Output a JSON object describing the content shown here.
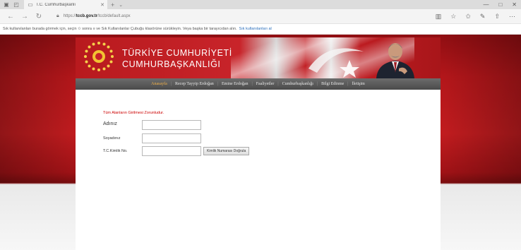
{
  "browser": {
    "tab_title": "T.C. Cumhurbaşkanlı",
    "address": {
      "prefix": "https://",
      "domain": "tccb.gov.tr",
      "path": "/tccb/default.aspx"
    },
    "favorites_bar": {
      "text": "Sık kullanılanları burada görmek için, seçin ✩ sonra ≡ ve Sık Kullanılanlar Çubuğu klasörüne sürükleyin. Veya başka bir tarayıcıdan alın.",
      "link": "Sık kullanılanları al"
    }
  },
  "header": {
    "line1": "TÜRKİYE CUMHURİYETİ",
    "line2": "CUMHURBAŞKANLIĞI"
  },
  "menu": {
    "items": [
      "Anasayfa",
      "Recep Tayyip Erdoğan",
      "Emine Erdoğan",
      "Faaliyetler",
      "Cumhurbaşkanlığı",
      "Bilgi Edinme",
      "İletişim"
    ]
  },
  "form": {
    "required_note": "Tüm Alanların Girilmesi Zorunludur.",
    "name_label": "Adınız",
    "surname_label": "Soyadınız",
    "tc_label": "T.C.Kimlik No.",
    "verify_button": "Kimlik Numarası Doğrula"
  },
  "colors": {
    "accent_red": "#b3161a",
    "menu_bg": "#555555",
    "menu_active": "#f0b04a",
    "required_text": "#cc0000"
  }
}
